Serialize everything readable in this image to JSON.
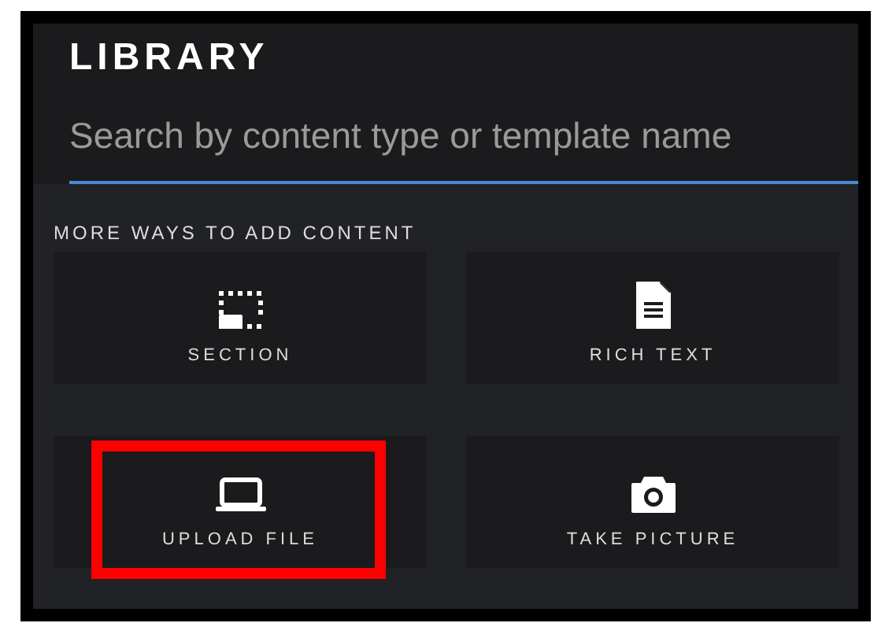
{
  "panel": {
    "title": "LIBRARY",
    "search": {
      "placeholder": "Search by content type or template name"
    },
    "section_heading": "MORE WAYS TO ADD CONTENT",
    "tiles": [
      {
        "label": "SECTION",
        "kind": "section",
        "highlighted": false
      },
      {
        "label": "RICH TEXT",
        "kind": "document",
        "highlighted": false
      },
      {
        "label": "UPLOAD FILE",
        "kind": "laptop",
        "highlighted": true
      },
      {
        "label": "TAKE PICTURE",
        "kind": "camera",
        "highlighted": false
      }
    ]
  }
}
